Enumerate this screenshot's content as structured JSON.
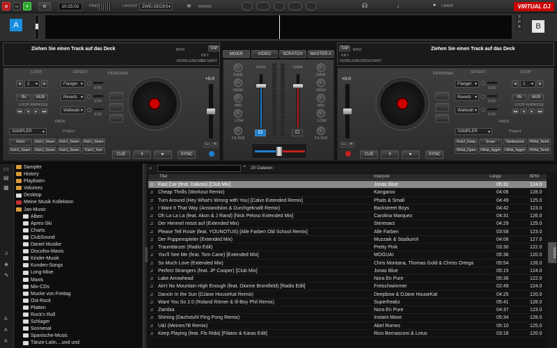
{
  "topbar": {
    "time": "10:25:02",
    "prio_label": "PRIO",
    "layout_label": "LAYOUT",
    "layout_value": "ZWEI DECKS",
    "user_label": "LMIER",
    "brand": "VIRTUAL DJ"
  },
  "decks": {
    "left": {
      "letter": "A",
      "track_prompt": "Ziehen Sie einen Track auf das Deck",
      "bpm_label": "BPM",
      "tap": "TAP",
      "key_label": "KEY",
      "gain_label": "VERBLEIBEND",
      "total_label": "GESAMT",
      "pitch": "+0.0"
    },
    "right": {
      "letter": "B",
      "track_prompt": "Ziehen Sie einen Track auf das Deck",
      "bpm_label": "BPM",
      "tap": "TAP",
      "key_label": "KEY",
      "gain_label": "VERBLEIBEND",
      "total_label": "GESAMT",
      "pitch": "+0.0"
    }
  },
  "side_letters": [
    "S",
    "R",
    "B"
  ],
  "mixer_tabs": [
    "MIXER",
    "VIDEO",
    "SCRATCH",
    "MASTER A"
  ],
  "mixer_labels": {
    "gain": "GAIN",
    "high": "HIGH",
    "mid": "MID",
    "low": "LOW",
    "filter": "FILTER"
  },
  "deck_controls": {
    "loop": "LOOP",
    "effekt": "EFFEKT",
    "personal": "PERSONAL",
    "loop_value": "2",
    "in": "IN",
    "aus": "AUS",
    "loop_advance": "LOOP ANPASSE",
    "pads": "PADS",
    "sampler": "SAMPLER",
    "project": "Project",
    "str": "STR",
    "cue": "CUE",
    "play": "►",
    "pause": "II",
    "sync": "SYNC",
    "left_effects": [
      "Flanger",
      "Reverb",
      "Wahwah"
    ],
    "right_effects": [
      "Flanger",
      "Reverb",
      "Wahwah"
    ],
    "left_pads": [
      "Kick1",
      "Kick1_Snare",
      "Kick1_Snare",
      "Kick1_Snare",
      "Kick1_Snare",
      "Kick1_Snare",
      "Kick1_Snare",
      "Kick1_Tom"
    ],
    "right_pads": [
      "Kick2_Deep",
      "Snare",
      "Tambourine",
      "HiHat_Temb",
      "HiHat_Open",
      "HiHat_Aggre",
      "HiHat_Aggre",
      "HiHat_Temb"
    ]
  },
  "browser": {
    "search_placeholder": "",
    "file_count": "20 Dateien",
    "columns": {
      "title": "Titel",
      "artist": "Interpret",
      "length": "Länge",
      "bpm": "BPM"
    },
    "side_tab": "Sidelist",
    "tree": [
      {
        "label": "Sampler",
        "level": 0,
        "icon": "folder-orange"
      },
      {
        "label": "History",
        "level": 0,
        "icon": "folder-orange"
      },
      {
        "label": "Playlisten",
        "level": 0,
        "icon": "folder-orange"
      },
      {
        "label": "Volumes",
        "level": 0,
        "icon": "folder-orange"
      },
      {
        "label": "Desktop",
        "level": 0,
        "icon": "folder-white"
      },
      {
        "label": "Meine Musik Kollektion",
        "level": 0,
        "icon": "folder-red"
      },
      {
        "label": "Jan-Music",
        "level": 0,
        "icon": "folder-orange"
      },
      {
        "label": "Alben",
        "level": 1,
        "icon": "folder-white"
      },
      {
        "label": "Apres-Ski",
        "level": 1,
        "icon": "folder-white"
      },
      {
        "label": "Charts",
        "level": 1,
        "icon": "folder-white"
      },
      {
        "label": "ClubSound",
        "level": 1,
        "icon": "folder-white"
      },
      {
        "label": "Daniel Musike",
        "level": 1,
        "icon": "folder-white"
      },
      {
        "label": "Discofox-Maxis",
        "level": 1,
        "icon": "folder-white"
      },
      {
        "label": "Kinder-Musik",
        "level": 1,
        "icon": "folder-white"
      },
      {
        "label": "Kunden-Songs",
        "level": 1,
        "icon": "folder-white"
      },
      {
        "label": "Long-Mixe",
        "level": 1,
        "icon": "folder-white"
      },
      {
        "label": "Maxis",
        "level": 1,
        "icon": "folder-white"
      },
      {
        "label": "Mix-CDs",
        "level": 1,
        "icon": "folder-white"
      },
      {
        "label": "Mucke von Freitag",
        "level": 1,
        "icon": "folder-white"
      },
      {
        "label": "Ost-Rock",
        "level": 1,
        "icon": "folder-white"
      },
      {
        "label": "Platten",
        "level": 1,
        "icon": "folder-white"
      },
      {
        "label": "Rock'n Roll",
        "level": 1,
        "icon": "folder-white"
      },
      {
        "label": "Schlager",
        "level": 1,
        "icon": "folder-white"
      },
      {
        "label": "Sonnenal",
        "level": 1,
        "icon": "folder-white"
      },
      {
        "label": "Spanische-Music",
        "level": 1,
        "icon": "folder-white"
      },
      {
        "label": "Tänze-Latin....und und",
        "level": 1,
        "icon": "folder-white"
      }
    ],
    "tracks": [
      {
        "title": "Fast Car (feat. Dakota) [Club Mix]",
        "artist": "Jonas Blue",
        "length": "05:31",
        "bpm": "124.0",
        "selected": true
      },
      {
        "title": "Cheap Thrills (Workout Remix)",
        "artist": "Kangaroo",
        "length": "04:06",
        "bpm": "128.0"
      },
      {
        "title": "Turn Around (Hey What's Wrong with You) [Calvo Extended Remix]",
        "artist": "Phats & Small",
        "length": "04:49",
        "bpm": "125.0"
      },
      {
        "title": "I Want It That Way (Anstandslos & Durchgeknallt Remix)",
        "artist": "Backstreet Boys",
        "length": "04:42",
        "bpm": "123.0"
      },
      {
        "title": "Oh La La La (feat. Akon & J Rand) [Nick Peloso Extended Mix]",
        "artist": "Carolina Marquez",
        "length": "04:31",
        "bpm": "126.0"
      },
      {
        "title": "Der Himmel reisst auf (Extended Mix)",
        "artist": "Stereoact",
        "length": "04:29",
        "bpm": "125.0"
      },
      {
        "title": "Please Tell Rosie (feat. YOUNOTUS) [Alle Farben Old School Remix]",
        "artist": "Alle Farben",
        "length": "03:58",
        "bpm": "123.0"
      },
      {
        "title": "Der Puppenspieler (Extended Mix)",
        "artist": "Muzzaik & StadiumX",
        "length": "04:06",
        "bpm": "127.0"
      },
      {
        "title": "Traumtänzer (Radio Edit)",
        "artist": "Pretty Pink",
        "length": "03:30",
        "bpm": "122.0"
      },
      {
        "title": "You'll See Me (feat. Tom Cane) [Extended Mix]",
        "artist": "MOGUAI",
        "length": "05:38",
        "bpm": "120.0"
      },
      {
        "title": "So Much Love (Extended Mix)",
        "artist": "Chris Montana, Thomas Gold & Chriss Ortega",
        "length": "05:54",
        "bpm": "128.0"
      },
      {
        "title": "Perfect Strangers (feat. JP Cooper) [Club Mix]",
        "artist": "Jonas Blue",
        "length": "05:15",
        "bpm": "124.0"
      },
      {
        "title": "Lake Arrowhead",
        "artist": "Nora En Pure",
        "length": "05:36",
        "bpm": "122.0"
      },
      {
        "title": "Ain't No Mountain High Enough (feat. Dionne Bromfield) [Radio Edit]",
        "artist": "Freischwimmer",
        "length": "02:49",
        "bpm": "124.0"
      },
      {
        "title": "Dancin In the Sun (DJane HouseKat Remix)",
        "artist": "Deepbow & DJane HouseKat",
        "length": "04:25",
        "bpm": "120.0"
      },
      {
        "title": "Want You So 2.0 (Roland Römer & Ill-Boy Phil Remix)",
        "artist": "Superfreakz",
        "length": "05:41",
        "bpm": "128.0"
      },
      {
        "title": "Zambia",
        "artist": "Nora En Pure",
        "length": "04:37",
        "bpm": "123.0"
      },
      {
        "title": "Shining (Dachstuhl Ping Pong Remix)",
        "artist": "Instant Move",
        "length": "05:34",
        "bpm": "128.0"
      },
      {
        "title": "U&I (Meines7B Remix)",
        "artist": "Abel Romez",
        "length": "05:10",
        "bpm": "125.0"
      },
      {
        "title": "Keep Playing (feat. Flo Rida) [Filatov & Karas Edit]",
        "artist": "Rico Bernasconi & Lotus",
        "length": "03:18",
        "bpm": "120.0"
      }
    ]
  },
  "colors": {
    "accent_blue": "#1f7fd0",
    "accent_red": "#c62020",
    "selected_row": "#8a8a8a"
  }
}
